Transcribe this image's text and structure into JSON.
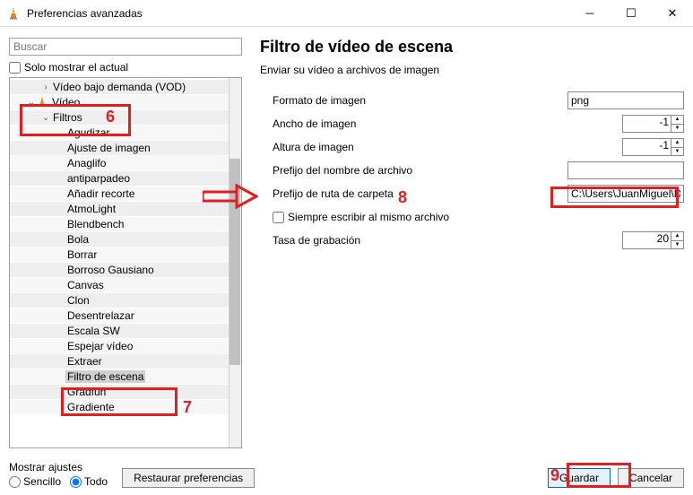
{
  "window": {
    "title": "Preferencias avanzadas"
  },
  "search": {
    "placeholder": "Buscar"
  },
  "only_current": {
    "label": "Solo mostrar el actual"
  },
  "tree": [
    {
      "label": "Vídeo bajo demanda (VOD)",
      "indent": 2,
      "exp": ">"
    },
    {
      "label": "Vídeo",
      "indent": 1,
      "exp": "v",
      "icon": "vlc"
    },
    {
      "label": "Filtros",
      "indent": 2,
      "exp": "v"
    },
    {
      "label": "Agudizar",
      "indent": 3
    },
    {
      "label": "Ajuste de imagen",
      "indent": 3
    },
    {
      "label": "Anaglifo",
      "indent": 3
    },
    {
      "label": "antiparpadeo",
      "indent": 3
    },
    {
      "label": "Añadir recorte",
      "indent": 3
    },
    {
      "label": "AtmoLight",
      "indent": 3
    },
    {
      "label": "Blendbench",
      "indent": 3
    },
    {
      "label": "Bola",
      "indent": 3
    },
    {
      "label": "Borrar",
      "indent": 3
    },
    {
      "label": "Borroso Gausiano",
      "indent": 3
    },
    {
      "label": "Canvas",
      "indent": 3
    },
    {
      "label": "Clon",
      "indent": 3
    },
    {
      "label": "Desentrelazar",
      "indent": 3
    },
    {
      "label": "Escala SW",
      "indent": 3
    },
    {
      "label": "Espejar vídeo",
      "indent": 3
    },
    {
      "label": "Extraer",
      "indent": 3
    },
    {
      "label": "Filtro de escena",
      "indent": 3,
      "selected": true
    },
    {
      "label": "Gradfun",
      "indent": 3
    },
    {
      "label": "Gradiente",
      "indent": 3
    }
  ],
  "panel": {
    "heading": "Filtro de vídeo de escena",
    "sub": "Enviar su vídeo a archivos de imagen",
    "format_label": "Formato de imagen",
    "format_value": "png",
    "width_label": "Ancho de imagen",
    "width_value": "-1",
    "height_label": "Altura de imagen",
    "height_value": "-1",
    "fname_label": "Prefijo del nombre de archivo",
    "fname_value": "",
    "path_label": "Prefijo de ruta de carpeta",
    "path_value": "C:\\Users\\JuanMiguel\\Docum",
    "always_label": "Siempre escribir al mismo archivo",
    "rate_label": "Tasa de grabación",
    "rate_value": "20"
  },
  "bottom": {
    "show_label": "Mostrar ajustes",
    "simple": "Sencillo",
    "all": "Todo",
    "reset": "Restaurar preferencias",
    "save": "Guardar",
    "cancel": "Cancelar"
  },
  "annotations": {
    "n6": "6",
    "n7": "7",
    "n8": "8",
    "n9": "9"
  }
}
